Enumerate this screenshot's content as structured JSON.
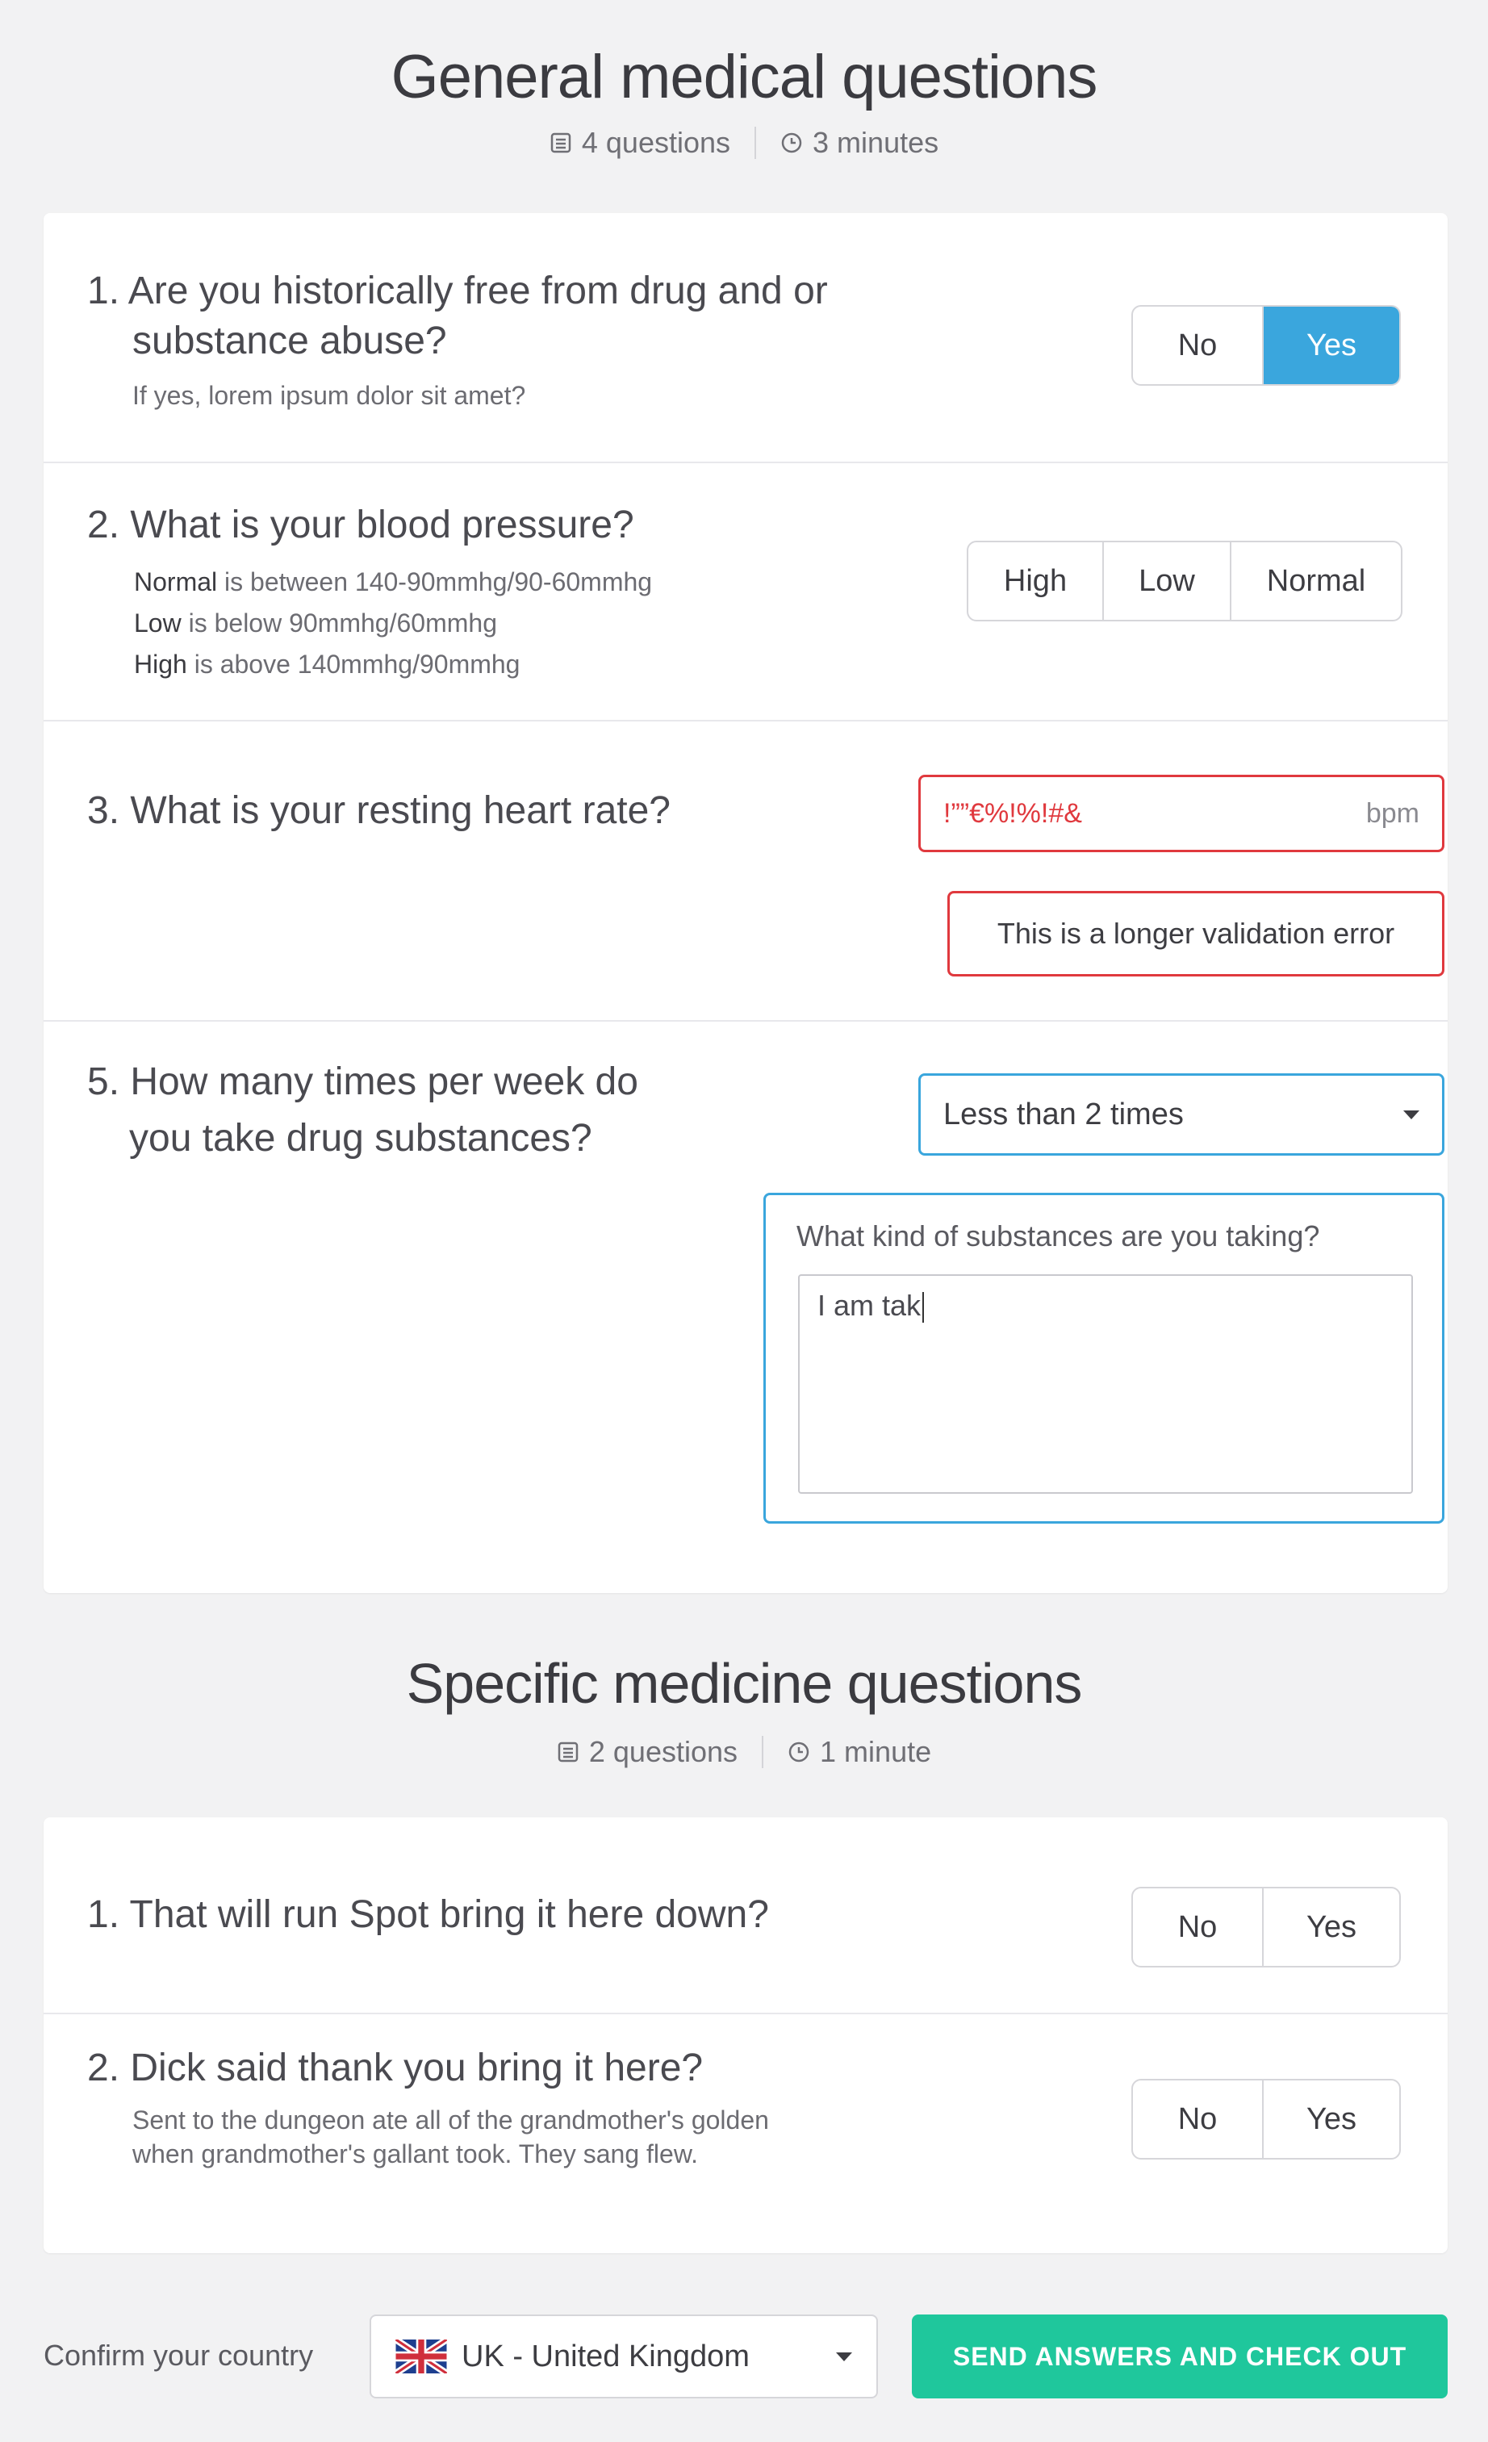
{
  "general": {
    "title": "General medical questions",
    "count": "4 questions",
    "time": "3 minutes"
  },
  "q1": {
    "text_line1": "1.  Are you historically free from drug and or",
    "text_line2": "substance abuse?",
    "hint": "If yes, lorem ipsum dolor sit amet?",
    "options": [
      "No",
      "Yes"
    ],
    "selected": "Yes"
  },
  "q2": {
    "text": "2. What is your blood pressure?",
    "hint_normal_term": "Normal",
    "hint_normal_rest": " is between 140-90mmhg/90-60mmhg",
    "hint_low_term": "Low",
    "hint_low_rest": " is below 90mmhg/60mmhg",
    "hint_high_term": "High",
    "hint_high_rest": " is above 140mmhg/90mmhg",
    "options": [
      "High",
      "Low",
      "Normal"
    ]
  },
  "q3": {
    "text": "3. What is your resting heart rate?",
    "value": "!””€%!%!#&",
    "unit": "bpm",
    "error": "This is a longer validation error"
  },
  "q5": {
    "text_line1": "5. How many times per week do",
    "text_line2": "you take drug substances?",
    "selected": "Less than 2 times",
    "followup_label": "What kind of substances are you taking?",
    "followup_value": "I am tak"
  },
  "specific": {
    "title": "Specific medicine questions",
    "count": "2 questions",
    "time": "1 minute"
  },
  "s1": {
    "text": "1.  That will run Spot bring it here down?",
    "options": [
      "No",
      "Yes"
    ]
  },
  "s2": {
    "text": "2. Dick said thank you bring it here?",
    "hint_line1": "Sent to the dungeon ate all of the grandmother's golden",
    "hint_line2": "when grandmother's gallant took. They sang flew.",
    "options": [
      "No",
      "Yes"
    ]
  },
  "footer": {
    "confirm_label": "Confirm your country",
    "country": "UK - United Kingdom",
    "cta": "SEND ANSWERS AND CHECK OUT"
  },
  "colors": {
    "accent_blue": "#3aa6dd",
    "error_red": "#e0393e",
    "cta_green": "#1fc79c"
  },
  "icons": {
    "count": "list-icon",
    "time": "clock-icon",
    "flag": "uk-flag-icon"
  }
}
